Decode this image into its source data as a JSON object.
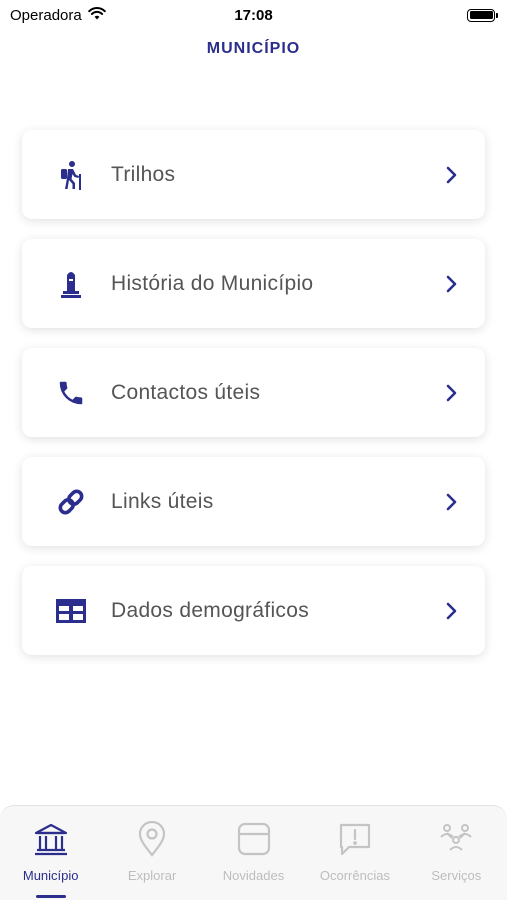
{
  "status": {
    "carrier": "Operadora",
    "time": "17:08"
  },
  "page": {
    "title": "MUNICÍPIO"
  },
  "menu": [
    {
      "label": "Trilhos",
      "icon": "hiking-icon"
    },
    {
      "label": "História do Município",
      "icon": "monument-icon"
    },
    {
      "label": "Contactos úteis",
      "icon": "phone-icon"
    },
    {
      "label": "Links úteis",
      "icon": "link-icon"
    },
    {
      "label": "Dados demográficos",
      "icon": "table-icon"
    }
  ],
  "tabs": [
    {
      "label": "Município",
      "icon": "institution-icon",
      "active": true
    },
    {
      "label": "Explorar",
      "icon": "map-pin-icon",
      "active": false
    },
    {
      "label": "Novidades",
      "icon": "news-icon",
      "active": false
    },
    {
      "label": "Ocorrências",
      "icon": "alert-bubble-icon",
      "active": false
    },
    {
      "label": "Serviços",
      "icon": "services-icon",
      "active": false
    }
  ],
  "colors": {
    "accent": "#2b2e8c",
    "inactive": "#c4c4c4",
    "text": "#555555"
  }
}
